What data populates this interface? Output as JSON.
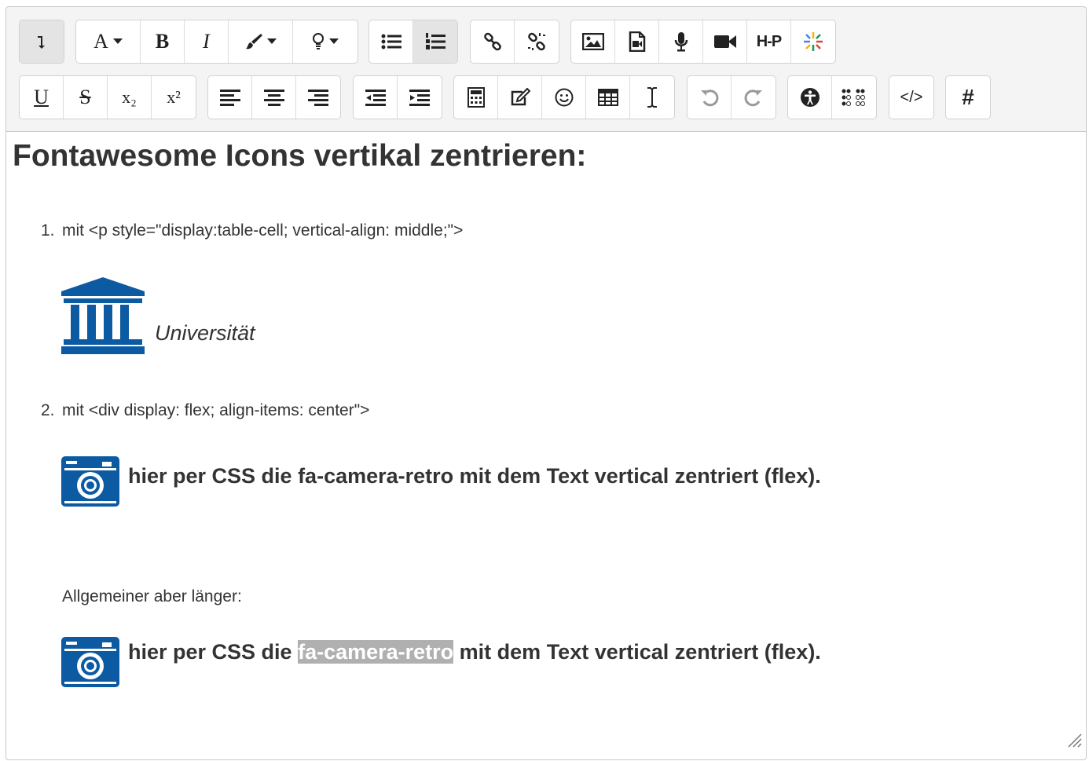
{
  "toolbar": {
    "font_label": "A",
    "bold_label": "B",
    "italic_label": "I",
    "underline_label": "U",
    "strike_label": "S",
    "sub_label": "x₂",
    "sup_label": "x²",
    "hp_label": "H-P",
    "hash_label": "#",
    "code_label": "</>"
  },
  "content": {
    "heading": "Fontawesome Icons vertikal zentrieren:",
    "item1_num": "1.",
    "item1_text": "mit <p style=\"display:table-cell; vertical-align: middle;\">",
    "uni_text": "Universität",
    "item2_num": "2.",
    "item2_text": "mit <div display: flex; align-items: center\">",
    "flex1_text": "hier per CSS die fa-camera-retro mit dem Text vertical zentriert (flex).",
    "general_text": "Allgemeiner aber länger:",
    "flex2_before": "hier per CSS die ",
    "flex2_selected": "fa-camera-retro",
    "flex2_after": " mit dem Text vertical zentriert (flex)."
  },
  "colors": {
    "icon_blue": "#0b5aa2",
    "selection_gray": "#b0b0b0"
  }
}
